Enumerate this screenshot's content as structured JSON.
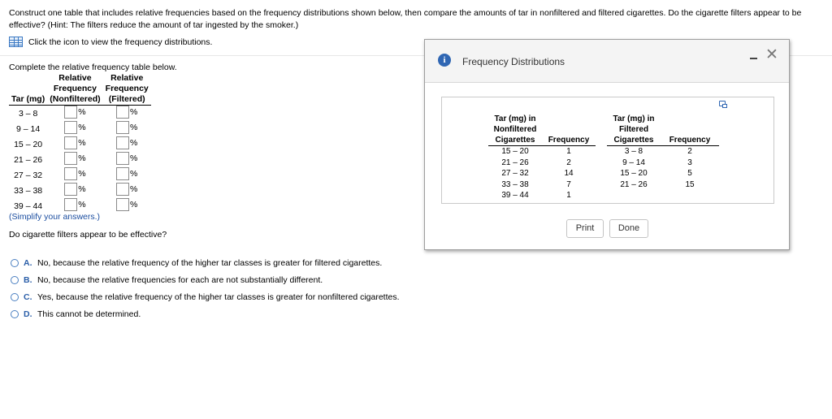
{
  "question": {
    "text": "Construct one table that includes relative frequencies based on the frequency distributions shown below, then compare the amounts of tar in nonfiltered and filtered cigarettes. Do the cigarette filters appear to be effective? (Hint: The filters reduce the amount of tar ingested by the smoker.)",
    "icon_prompt": "Click the icon to view the frequency distributions."
  },
  "rel_table": {
    "intro": "Complete the relative frequency table below.",
    "headers": {
      "tar": "Tar (mg)",
      "nonfiltered_l1": "Relative",
      "nonfiltered_l2": "Frequency",
      "nonfiltered_l3": "(Nonfiltered)",
      "filtered_l1": "Relative",
      "filtered_l2": "Frequency",
      "filtered_l3": "(Filtered)"
    },
    "unit": "%",
    "rows": [
      {
        "tar": "3 – 8"
      },
      {
        "tar": "9 – 14"
      },
      {
        "tar": "15 – 20"
      },
      {
        "tar": "21 – 26"
      },
      {
        "tar": "27 – 32"
      },
      {
        "tar": "33 – 38"
      },
      {
        "tar": "39 – 44"
      }
    ],
    "simplify": "(Simplify your answers.)"
  },
  "effective_question": "Do cigarette filters appear to be effective?",
  "options": [
    {
      "letter": "A.",
      "text": "No, because the relative frequency of the higher tar classes is greater for filtered cigarettes."
    },
    {
      "letter": "B.",
      "text": "No, because the relative frequencies for each are not substantially different."
    },
    {
      "letter": "C.",
      "text": "Yes, because the relative frequency of the higher tar classes is greater for nonfiltered cigarettes."
    },
    {
      "letter": "D.",
      "text": "This cannot be determined."
    }
  ],
  "dialog": {
    "title": "Frequency Distributions",
    "minimize_glyph": "-",
    "close_glyph": "✕",
    "headers": {
      "nonfiltered_l1": "Tar (mg) in",
      "nonfiltered_l2": "Nonfiltered",
      "nonfiltered_l3": "Cigarettes",
      "frequency": "Frequency",
      "filtered_l1": "Tar (mg) in",
      "filtered_l2": "Filtered",
      "filtered_l3": "Cigarettes",
      "frequency2": "Frequency"
    },
    "rows": [
      {
        "nf_tar": "15 – 20",
        "nf_freq": "1",
        "f_tar": "3 – 8",
        "f_freq": "2"
      },
      {
        "nf_tar": "21 – 26",
        "nf_freq": "2",
        "f_tar": "9 – 14",
        "f_freq": "3"
      },
      {
        "nf_tar": "27 – 32",
        "nf_freq": "14",
        "f_tar": "15 – 20",
        "f_freq": "5"
      },
      {
        "nf_tar": "33 – 38",
        "nf_freq": "7",
        "f_tar": "21 – 26",
        "f_freq": "15"
      },
      {
        "nf_tar": "39 – 44",
        "nf_freq": "1",
        "f_tar": "",
        "f_freq": ""
      }
    ],
    "print_label": "Print",
    "done_label": "Done"
  },
  "colors": {
    "accent": "#2f66b3",
    "link_text": "#1c4ea0"
  }
}
